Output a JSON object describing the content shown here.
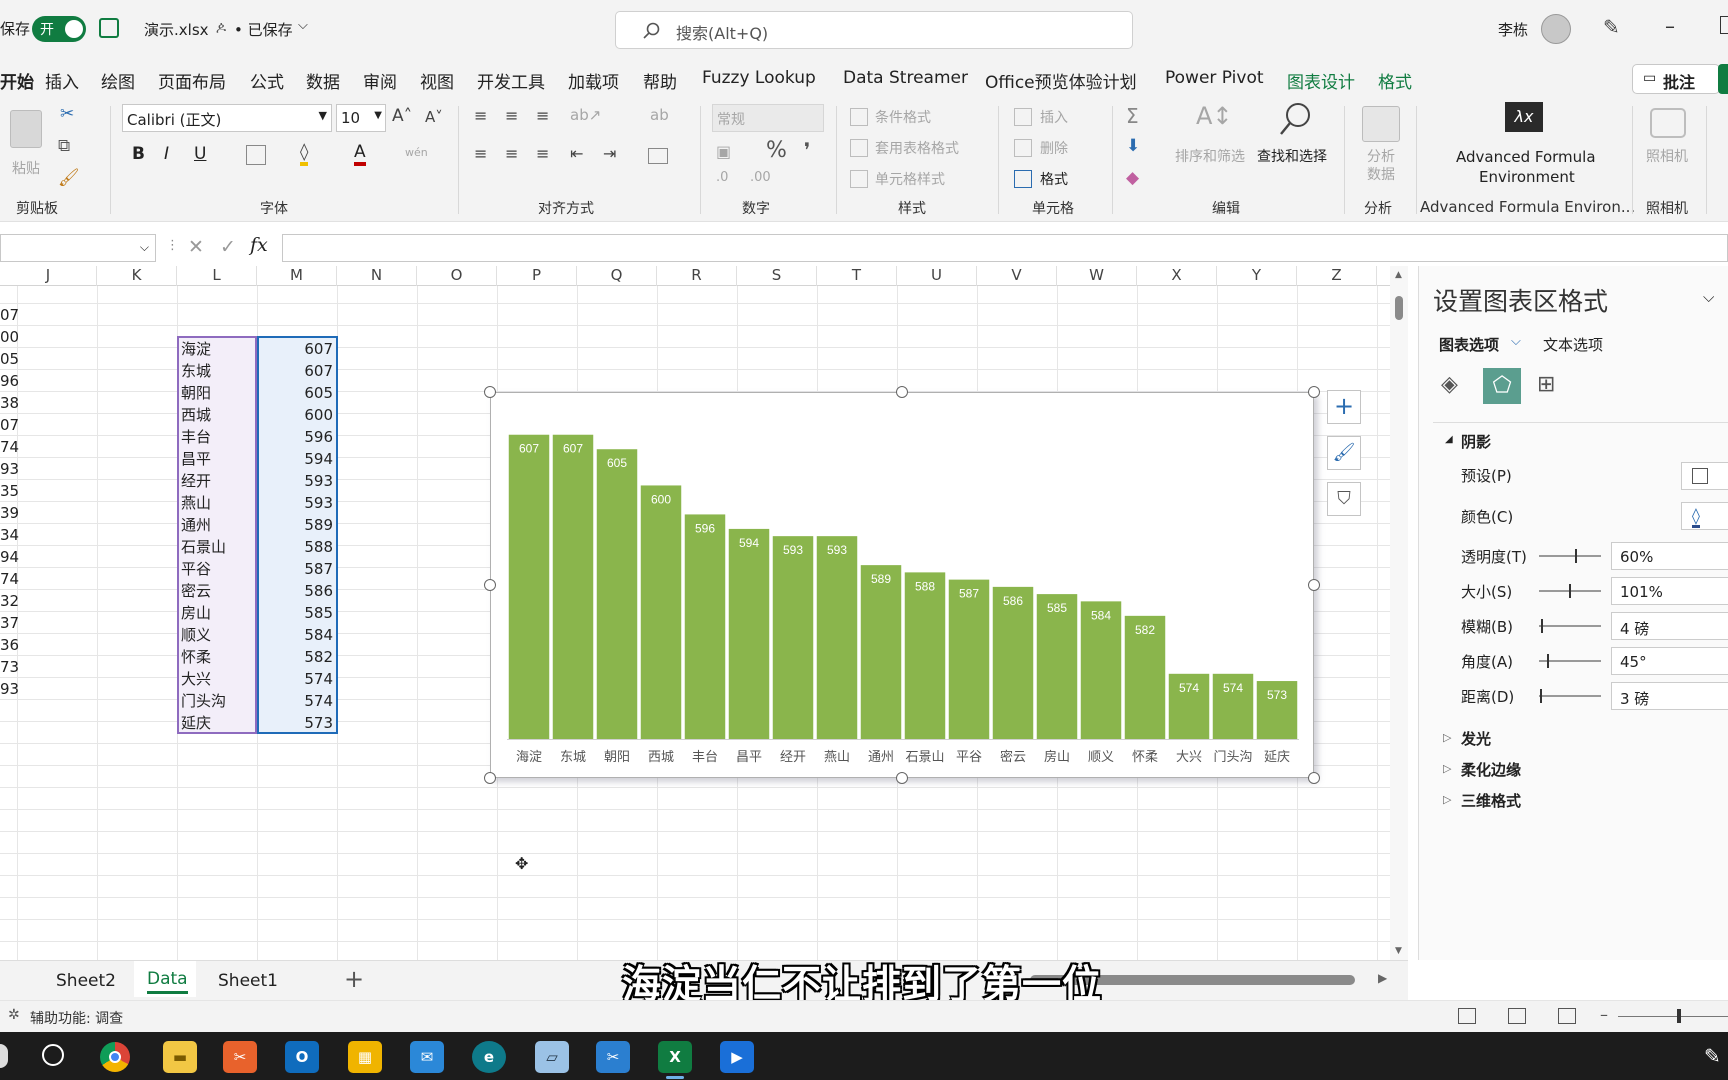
{
  "title_bar": {
    "autosave_label": "保存",
    "autosave_toggle": "开",
    "file_name": "演示.xlsx",
    "save_status": "• 已保存",
    "search_placeholder": "搜索(Alt+Q)",
    "user_name": "李栋"
  },
  "menu": {
    "items": [
      "开始",
      "插入",
      "绘图",
      "页面布局",
      "公式",
      "数据",
      "审阅",
      "视图",
      "开发工具",
      "加载项",
      "帮助",
      "Fuzzy Lookup",
      "Data Streamer",
      "Office预览体验计划",
      "Power Pivot",
      "图表设计",
      "格式"
    ],
    "comments_button": "批注"
  },
  "ribbon": {
    "clipboard": {
      "paste": "粘贴",
      "group": "剪贴板"
    },
    "font": {
      "name": "Calibri (正文)",
      "size": "10",
      "group": "字体"
    },
    "alignment": {
      "group": "对齐方式"
    },
    "number": {
      "format": "常规",
      "group": "数字"
    },
    "styles": {
      "conditional": "条件格式",
      "table": "套用表格格式",
      "cell": "单元格样式",
      "group": "样式"
    },
    "cells": {
      "insert": "插入",
      "delete": "删除",
      "format": "格式",
      "group": "单元格"
    },
    "editing": {
      "sort": "排序和筛选",
      "find": "查找和选择",
      "group": "编辑"
    },
    "analysis": {
      "button": "分析数据",
      "group": "分析"
    },
    "afe": {
      "button_line1": "Advanced Formula",
      "button_line2": "Environment",
      "group": "Advanced Formula Environ..."
    },
    "camera": {
      "button": "照相机",
      "group": "照相机"
    }
  },
  "formula_bar": {
    "fx": "fx",
    "value": ""
  },
  "columns": [
    "J",
    "K",
    "L",
    "M",
    "N",
    "O",
    "P",
    "Q",
    "R",
    "S",
    "T",
    "U",
    "V",
    "W",
    "X",
    "Y",
    "Z"
  ],
  "cut_values": [
    "07",
    "00",
    "05",
    "96",
    "38",
    "07",
    "74",
    "93",
    "35",
    "39",
    "34",
    "94",
    "74",
    "32",
    "37",
    "36",
    "73",
    "93"
  ],
  "table_rows": [
    {
      "district": "海淀",
      "value": "607"
    },
    {
      "district": "东城",
      "value": "607"
    },
    {
      "district": "朝阳",
      "value": "605"
    },
    {
      "district": "西城",
      "value": "600"
    },
    {
      "district": "丰台",
      "value": "596"
    },
    {
      "district": "昌平",
      "value": "594"
    },
    {
      "district": "经开",
      "value": "593"
    },
    {
      "district": "燕山",
      "value": "593"
    },
    {
      "district": "通州",
      "value": "589"
    },
    {
      "district": "石景山",
      "value": "588"
    },
    {
      "district": "平谷",
      "value": "587"
    },
    {
      "district": "密云",
      "value": "586"
    },
    {
      "district": "房山",
      "value": "585"
    },
    {
      "district": "顺义",
      "value": "584"
    },
    {
      "district": "怀柔",
      "value": "582"
    },
    {
      "district": "大兴",
      "value": "574"
    },
    {
      "district": "门头沟",
      "value": "574"
    },
    {
      "district": "延庆",
      "value": "573"
    }
  ],
  "chart_data": {
    "type": "bar",
    "categories": [
      "海淀",
      "东城",
      "朝阳",
      "西城",
      "丰台",
      "昌平",
      "经开",
      "燕山",
      "通州",
      "石景山",
      "平谷",
      "密云",
      "房山",
      "顺义",
      "怀柔",
      "大兴",
      "门头沟",
      "延庆"
    ],
    "values": [
      607,
      607,
      605,
      600,
      596,
      594,
      593,
      593,
      589,
      588,
      587,
      586,
      585,
      584,
      582,
      574,
      574,
      573
    ],
    "title": "",
    "xlabel": "",
    "ylabel": "",
    "ylim": [
      565,
      610
    ],
    "grid": false,
    "legend": "none",
    "bar_color": "#8ab54c"
  },
  "pane": {
    "title": "设置图表区格式",
    "tab_chart_options": "图表选项",
    "tab_text_options": "文本选项",
    "section_shadow": "阴影",
    "preset_label": "预设(P)",
    "color_label": "颜色(C)",
    "transparency_label": "透明度(T)",
    "transparency_value": "60%",
    "transparency_level": 0.6,
    "size_label": "大小(S)",
    "size_value": "101%",
    "size_level": 0.5,
    "blur_label": "模糊(B)",
    "blur_value": "4 磅",
    "blur_level": 0.04,
    "angle_label": "角度(A)",
    "angle_value": "45°",
    "angle_level": 0.13,
    "distance_label": "距离(D)",
    "distance_value": "3 磅",
    "distance_level": 0.02,
    "section_glow": "发光",
    "section_soft_edges": "柔化边缘",
    "section_3d": "三维格式"
  },
  "sheets": [
    "Sheet2",
    "Data",
    "Sheet1"
  ],
  "active_sheet": "Data",
  "status": {
    "accessibility": "辅助功能: 调查"
  },
  "subtitle": "海淀当仁不让排到了第一位",
  "colors": {
    "accent_green": "#107c41",
    "bar": "#8ab54c",
    "selection_blue": "#1f6bb8",
    "selection_purple": "#8e6bbf"
  }
}
